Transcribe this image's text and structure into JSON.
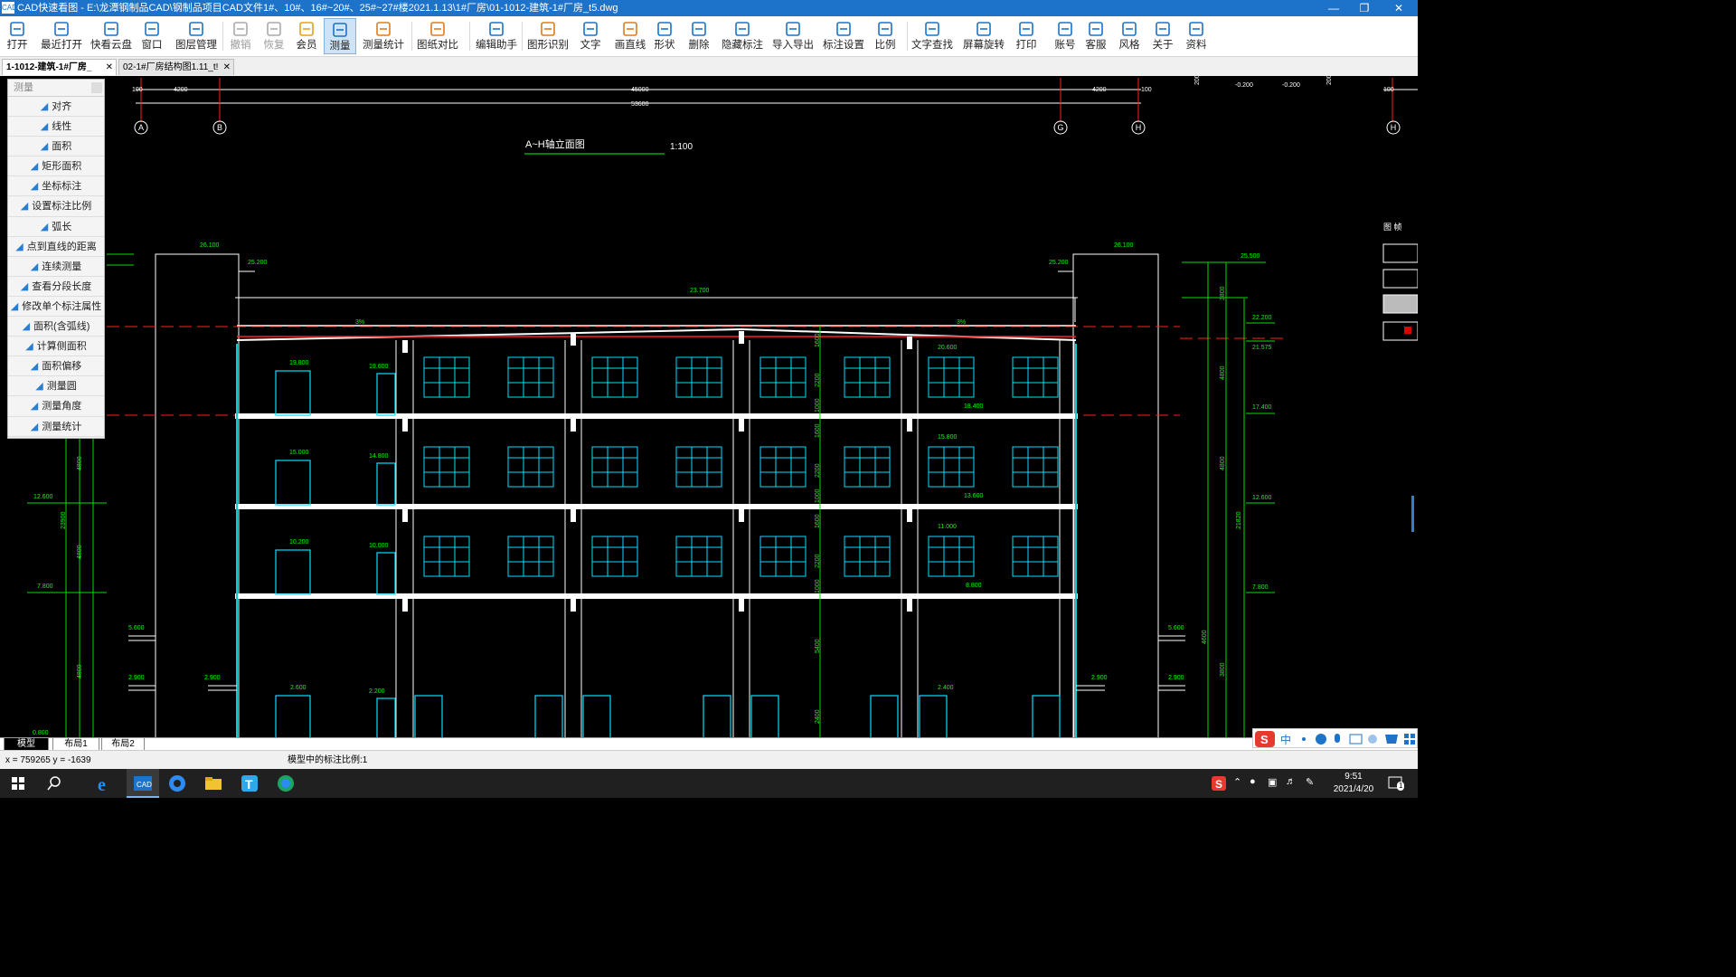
{
  "titlebar": {
    "app_icon_label": "CAD",
    "title": "CAD快速看图 - E:\\龙潭钢制品CAD\\钢制品项目CAD文件1#、10#、16#~20#、25#~27#楼2021.1.13\\1#厂房\\01-1012-建筑-1#厂房_t5.dwg"
  },
  "toolbar": [
    {
      "name": "open",
      "label": "打开",
      "icon": "folder-icon",
      "color": "#1c73c9"
    },
    {
      "name": "recent-open",
      "label": "最近打开",
      "icon": "clock-icon",
      "color": "#1c73c9"
    },
    {
      "name": "cloud-disk",
      "label": "快看云盘",
      "icon": "cloud-icon",
      "color": "#1c73c9"
    },
    {
      "name": "window",
      "label": "窗口",
      "icon": "window-icon",
      "color": "#1c73c9"
    },
    {
      "name": "layer-manage",
      "label": "图层管理",
      "icon": "layers-icon",
      "color": "#1c73c9"
    },
    {
      "name": "undo",
      "label": "撤销",
      "icon": "undo-icon",
      "color": "#aaaaaa"
    },
    {
      "name": "redo",
      "label": "恢复",
      "icon": "redo-icon",
      "color": "#aaaaaa"
    },
    {
      "name": "vip",
      "label": "会员",
      "icon": "vip-icon",
      "color": "#e6a21c"
    },
    {
      "name": "measure",
      "label": "测量",
      "icon": "measure-icon",
      "color": "#1c73c9"
    },
    {
      "name": "measure-stats",
      "label": "测量统计",
      "icon": "measure-stats-icon",
      "color": "#e07b1c"
    },
    {
      "name": "drawing-compare",
      "label": "图纸对比",
      "icon": "compare-icon",
      "color": "#e07b1c"
    },
    {
      "name": "edit-assistant",
      "label": "编辑助手",
      "icon": "edit-icon",
      "color": "#1c73c9"
    },
    {
      "name": "shape-recognize",
      "label": "图形识别",
      "icon": "recognize-icon",
      "color": "#e07b1c"
    },
    {
      "name": "text",
      "label": "文字",
      "icon": "text-icon",
      "color": "#1c73c9"
    },
    {
      "name": "draw-line",
      "label": "画直线",
      "icon": "line-icon",
      "color": "#e07b1c"
    },
    {
      "name": "shape",
      "label": "形状",
      "icon": "shape-icon",
      "color": "#1c73c9"
    },
    {
      "name": "delete",
      "label": "删除",
      "icon": "eraser-icon",
      "color": "#1c73c9"
    },
    {
      "name": "hide-annotation",
      "label": "隐藏标注",
      "icon": "eye-icon",
      "color": "#1c73c9"
    },
    {
      "name": "import-export",
      "label": "导入导出",
      "icon": "export-icon",
      "color": "#1c73c9"
    },
    {
      "name": "annotation-settings",
      "label": "标注设置",
      "icon": "settings-pen-icon",
      "color": "#1c73c9"
    },
    {
      "name": "scale",
      "label": "比例",
      "icon": "scale-icon",
      "color": "#1c73c9"
    },
    {
      "name": "text-search",
      "label": "文字查找",
      "icon": "search-doc-icon",
      "color": "#1c73c9"
    },
    {
      "name": "screen-rotate",
      "label": "屏幕旋转",
      "icon": "rotate-icon",
      "color": "#1c73c9"
    },
    {
      "name": "print",
      "label": "打印",
      "icon": "printer-icon",
      "color": "#1c73c9"
    },
    {
      "name": "account",
      "label": "账号",
      "icon": "user-icon",
      "color": "#1c73c9"
    },
    {
      "name": "customer-service",
      "label": "客服",
      "icon": "headset-icon",
      "color": "#1c73c9"
    },
    {
      "name": "style",
      "label": "风格",
      "icon": "style-icon",
      "color": "#1c73c9"
    },
    {
      "name": "about",
      "label": "关于",
      "icon": "info-icon",
      "color": "#1c73c9"
    },
    {
      "name": "materials",
      "label": "资料",
      "icon": "docs-icon",
      "color": "#1c73c9"
    }
  ],
  "tabs": [
    {
      "label": "1-1012-建筑-1#厂房_",
      "active": true
    },
    {
      "label": "02-1#厂房结构图1.11_t!",
      "active": false
    }
  ],
  "measure_panel": {
    "title": "测量",
    "items": [
      "对齐",
      "线性",
      "面积",
      "矩形面积",
      "坐标标注",
      "设置标注比例",
      "弧长",
      "点到直线的距离",
      "连续测量",
      "查看分段长度",
      "修改单个标注属性",
      "面积(含弧线)",
      "计算侧面积",
      "面积偏移",
      "测量圆",
      "测量角度",
      "测量统计"
    ]
  },
  "drawing": {
    "title": "A~H轴立面图",
    "scale": "1:100",
    "axes": [
      "A",
      "B",
      "G",
      "H",
      "H"
    ],
    "top_dims": [
      "100",
      "4200",
      "45000",
      "4200",
      "100",
      "53600",
      "100"
    ],
    "top_levels": [
      "-0.200",
      "-0.200",
      "200",
      "200"
    ],
    "level_labels": [
      "26.100",
      "25.200",
      "23.700",
      "26.100",
      "25.200",
      "25.500",
      "22.200",
      "21.575",
      "17.400",
      "12.600",
      "12.600",
      "7.800",
      "7.800",
      "5.600",
      "5.600",
      "2.900",
      "2.900",
      "2.900",
      "2.900",
      "0.800"
    ],
    "window_levels": [
      "19.800",
      "19.600",
      "15.000",
      "14.800",
      "10.200",
      "10.000",
      "2.600",
      "2.200",
      "20.600",
      "18.400",
      "15.800",
      "13.600",
      "11.000",
      "8.800",
      "2.400"
    ],
    "vertical_dims": [
      "1600",
      "2200",
      "1000",
      "1600",
      "2200",
      "1000",
      "1600",
      "2200",
      "1000",
      "5400",
      "2400",
      "4800",
      "4800",
      "4800",
      "23900",
      "21820",
      "3800",
      "4800",
      "4800",
      "4600",
      "3800"
    ],
    "slope": "3%",
    "side_label": "图 帧"
  },
  "layout_tabs": [
    {
      "label": "模型",
      "active": true
    },
    {
      "label": "布局1",
      "active": false
    },
    {
      "label": "布局2",
      "active": false
    }
  ],
  "statusbar": {
    "coords": "x = 759265  y = -1639",
    "scale_text": "模型中的标注比例:1"
  },
  "taskbar": {
    "time": "9:51",
    "date": "2021/4/20",
    "ime_label": "中",
    "notification_count": "1"
  }
}
